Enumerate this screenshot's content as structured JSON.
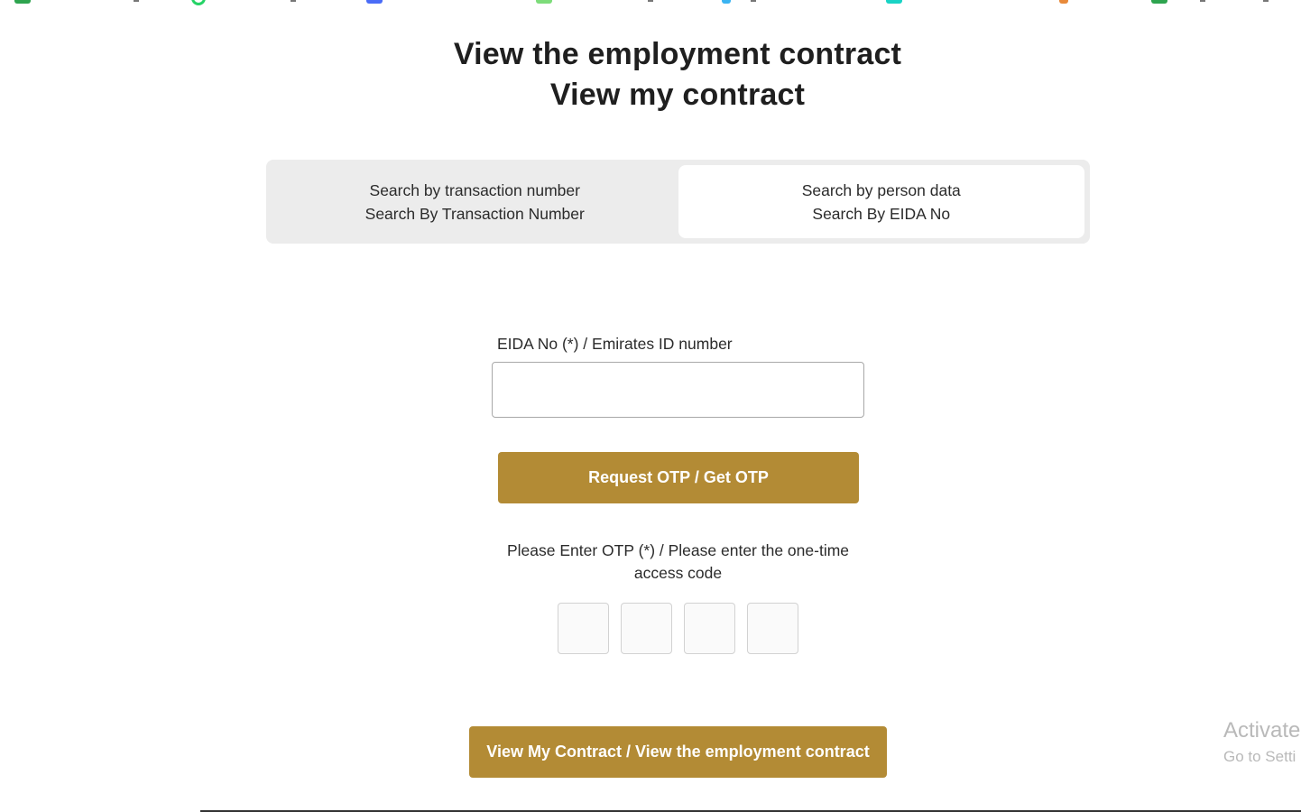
{
  "header": {
    "title_line1": "View the employment contract",
    "title_line2": "View my contract"
  },
  "tabs": [
    {
      "line1": "Search by transaction number",
      "line2": "Search By Transaction Number",
      "active": false
    },
    {
      "line1": "Search by person data",
      "line2": "Search By EIDA No",
      "active": true
    }
  ],
  "form": {
    "eida_label": "EIDA No (*) / Emirates ID number",
    "eida_value": "",
    "request_otp_label": "Request OTP / Get OTP",
    "otp_label": "Please Enter OTP (*) / Please enter the one-time access code",
    "otp_digits": [
      "",
      "",
      "",
      ""
    ],
    "view_contract_label": "View My Contract / View the employment contract"
  },
  "colors": {
    "accent": "#b38b35",
    "tab_track": "#ececec",
    "text": "#1f1f1f"
  },
  "watermark": {
    "line1": "Activate",
    "line2": "Go to Setti"
  },
  "icons": [
    "bookmark-favicon-green",
    "whatsapp-icon",
    "bookmark-favicon-blue",
    "bookmark-favicon-lime",
    "bookmark-favicon-sky",
    "bookmark-favicon-teal",
    "bookmark-favicon-orange",
    "bookmark-favicon-green"
  ]
}
